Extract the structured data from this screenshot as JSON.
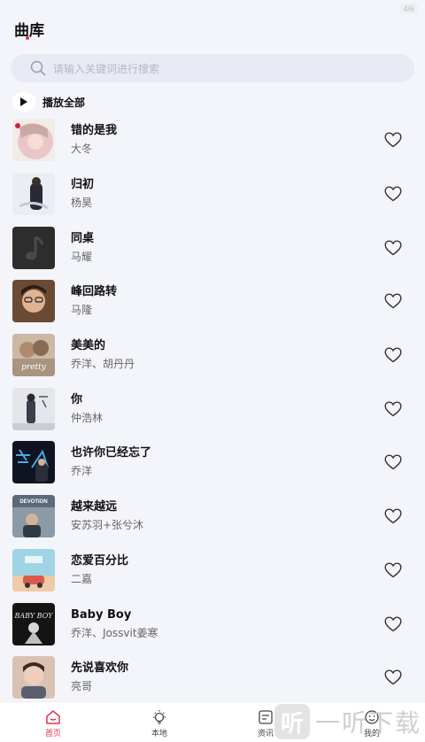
{
  "status": {
    "chip": "4/6"
  },
  "header": {
    "title": "曲库"
  },
  "search": {
    "placeholder": "请输入关键词进行搜索"
  },
  "play_all": {
    "label": "播放全部"
  },
  "songs": [
    {
      "title": "错的是我",
      "artist": "大冬"
    },
    {
      "title": "归初",
      "artist": "杨昊"
    },
    {
      "title": "同桌",
      "artist": "马耀"
    },
    {
      "title": "峰回路转",
      "artist": "马隆"
    },
    {
      "title": "美美的",
      "artist": "乔洋、胡丹丹"
    },
    {
      "title": "你",
      "artist": "仲浩林"
    },
    {
      "title": "也许你已经忘了",
      "artist": "乔洋"
    },
    {
      "title": "越来越远",
      "artist": "安苏羽+张兮沐"
    },
    {
      "title": "恋爱百分比",
      "artist": "二嘉"
    },
    {
      "title": "Baby Boy",
      "artist": "乔洋、Jossvit姜寒"
    },
    {
      "title": "先说喜欢你",
      "artist": "亮哥"
    }
  ],
  "covers": {
    "c4_text": "pretty",
    "c7_text": "DEVOTION",
    "c9_text": "BABY BOY"
  },
  "nav": [
    {
      "label": "首页",
      "icon": "home-icon",
      "active": true
    },
    {
      "label": "本地",
      "icon": "bulb-icon",
      "active": false
    },
    {
      "label": "资讯",
      "icon": "news-icon",
      "active": false
    },
    {
      "label": "我的",
      "icon": "profile-icon",
      "active": false
    }
  ],
  "watermark": {
    "logo": "听",
    "text": "一听下载"
  },
  "colors": {
    "accent": "#e8344e",
    "background": "#f4f5fb",
    "search_bg": "#e8ebf4"
  }
}
